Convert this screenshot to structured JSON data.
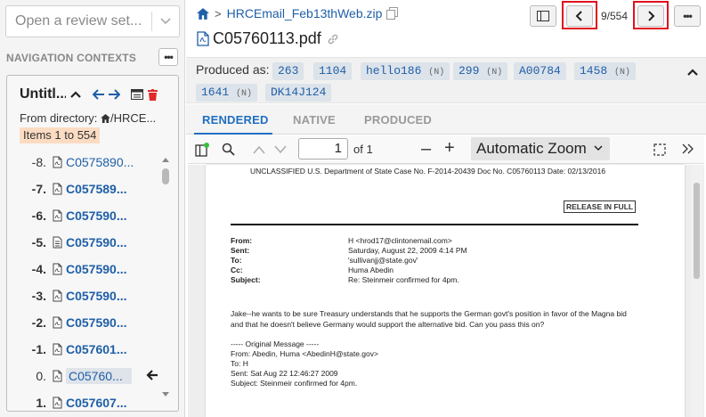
{
  "review_set": {
    "placeholder": "Open a review set..."
  },
  "navigation": {
    "section_label": "NAVIGATION CONTEXTS",
    "context": {
      "title": "Untitl...",
      "from_directory": "From directory: ",
      "directory": "/HRCE...",
      "items_badge": "Items 1 to 554"
    },
    "rows": [
      {
        "index": "-8.",
        "label": "C0575890...",
        "bold": false,
        "icon": "pdf-icon"
      },
      {
        "index": "-7.",
        "label": "C057589...",
        "bold": true,
        "icon": "pdf-icon"
      },
      {
        "index": "-6.",
        "label": "C057590...",
        "bold": true,
        "icon": "pdf-icon"
      },
      {
        "index": "-5.",
        "label": "C057590...",
        "bold": true,
        "icon": "text-file-icon"
      },
      {
        "index": "-4.",
        "label": "C057590...",
        "bold": true,
        "icon": "pdf-icon"
      },
      {
        "index": "-3.",
        "label": "C057590...",
        "bold": true,
        "icon": "pdf-icon"
      },
      {
        "index": "-2.",
        "label": "C057590...",
        "bold": true,
        "icon": "pdf-icon"
      },
      {
        "index": "-1.",
        "label": "C057601...",
        "bold": true,
        "icon": "pdf-icon"
      },
      {
        "index": "0.",
        "label": "C05760...",
        "bold": false,
        "icon": "pdf-icon",
        "current": true
      },
      {
        "index": "1.",
        "label": "C057607...",
        "bold": true,
        "icon": "pdf-icon"
      }
    ]
  },
  "document": {
    "breadcrumb_zip": "HRCEmail_Feb13thWeb.zip",
    "title": "C05760113.pdf",
    "counter": "9/554"
  },
  "produced": {
    "label": "Produced as:",
    "chips": [
      {
        "text": "263",
        "suffix": ""
      },
      {
        "text": "1104",
        "suffix": ""
      },
      {
        "text": "hello186",
        "suffix": "(N)"
      },
      {
        "text": "299",
        "suffix": "(N)"
      },
      {
        "text": "A00784",
        "suffix": ""
      },
      {
        "text": "1458",
        "suffix": "(N)"
      },
      {
        "text": "1641",
        "suffix": "(N)"
      },
      {
        "text": "DK14J124",
        "suffix": ""
      }
    ]
  },
  "tabs": [
    {
      "label": "RENDERED",
      "active": true
    },
    {
      "label": "NATIVE",
      "active": false
    },
    {
      "label": "PRODUCED",
      "active": false
    }
  ],
  "pdf": {
    "page_value": "1",
    "of_label": "of 1",
    "zoom": "Automatic Zoom",
    "header_line": "UNCLASSIFIED  U.S. Department of State  Case No. F-2014-20439 Doc No. C05760113  Date: 02/13/2016",
    "release": "RELEASE IN FULL",
    "memo": [
      {
        "k": "From:",
        "v": "H <hrod17@clintonemail.com>"
      },
      {
        "k": "Sent:",
        "v": "Saturday, August 22, 2009 4:14 PM"
      },
      {
        "k": "To:",
        "v": "'sullivanjj@state.gov'"
      },
      {
        "k": "Cc:",
        "v": "Huma Abedin"
      },
      {
        "k": "Subject:",
        "v": "Re: Steinmeir confirmed for 4pm."
      }
    ],
    "body1": "Jake--he wants to be sure Treasury understands that he supports the German govt's position in favor of the Magna bid",
    "body2": "and that he doesn't believe Germany would support the alternative bid. Can you pass this on?",
    "orig_header": "----- Original Message -----",
    "orig": [
      "From: Abedin, Huma <AbedinH@state.gov>",
      "To: H",
      "Sent: Sat Aug 22 12:46:27 2009",
      "Subject: Steinmeir confirmed for 4pm."
    ]
  },
  "colors": {
    "accent": "#1f6fc0",
    "link": "#1f5fa8",
    "badge": "#fbdcc3",
    "delete": "#e02a2a",
    "highlight": "#e01020"
  }
}
